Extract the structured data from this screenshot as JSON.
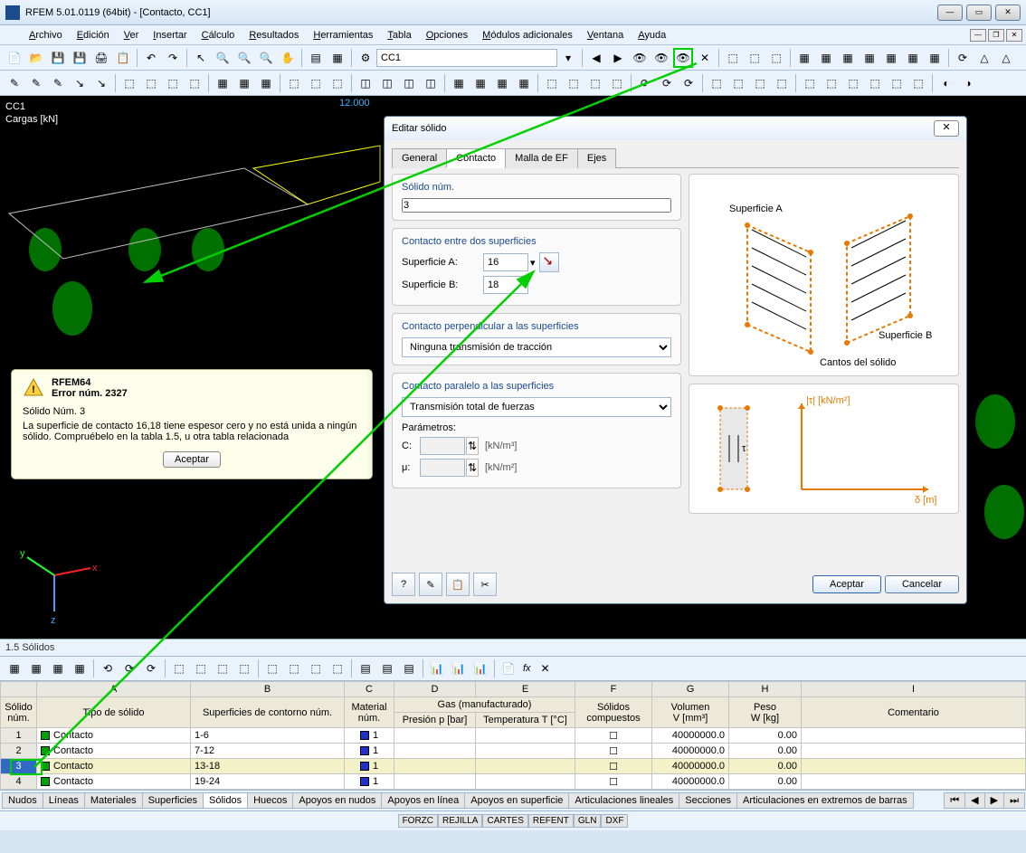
{
  "window": {
    "title": "RFEM 5.01.0119 (64bit) - [Contacto, CC1]"
  },
  "menu": [
    "Archivo",
    "Edición",
    "Ver",
    "Insertar",
    "Cálculo",
    "Resultados",
    "Herramientas",
    "Tabla",
    "Opciones",
    "Módulos adicionales",
    "Ventana",
    "Ayuda"
  ],
  "toolbar_combo": {
    "value": "CC1"
  },
  "viewport": {
    "label1": "CC1",
    "label2": "Cargas [kN]",
    "dim": "12.000",
    "axis_x": "x",
    "axis_y": "y",
    "axis_z": "z"
  },
  "error": {
    "title": "RFEM64",
    "subtitle": "Error núm. 2327",
    "line1": "Sólido Núm. 3",
    "line2": "La superficie de contacto 16,18 tiene espesor cero y no está unida a ningún sólido. Compruébelo en la tabla 1.5, u otra tabla relacionada",
    "accept": "Aceptar"
  },
  "dialog": {
    "title": "Editar sólido",
    "tabs": [
      "General",
      "Contacto",
      "Malla de EF",
      "Ejes"
    ],
    "active_tab": 1,
    "sec1": {
      "title": "Sólido núm.",
      "value": "3"
    },
    "sec2": {
      "title": "Contacto entre dos superficies",
      "labelA": "Superficie A:",
      "valA": "16",
      "labelB": "Superficie B:",
      "valB": "18"
    },
    "sec3": {
      "title": "Contacto perpendicular a las superficies",
      "value": "Ninguna transmisión de tracción"
    },
    "sec4": {
      "title": "Contacto paralelo a las superficies",
      "value": "Transmisión total de fuerzas",
      "params_label": "Parámetros:",
      "c_label": "C:",
      "c_unit": "[kN/m³]",
      "mu_label": "μ:",
      "mu_unit": "[kN/m²]"
    },
    "diagram_labels": {
      "surfA": "Superficie A",
      "surfB": "Superficie B",
      "edges": "Cantos del sólido",
      "tau": "|τ| [kN/m²]",
      "delta": "δ [m]"
    },
    "accept": "Aceptar",
    "cancel": "Cancelar"
  },
  "table": {
    "caption": "1.5 Sólidos",
    "fx": "fx",
    "col_letters": [
      "",
      "A",
      "B",
      "C",
      "D",
      "E",
      "F",
      "G",
      "H",
      "I"
    ],
    "headers_r1": {
      "num": "Sólido\nnúm.",
      "tipo": "Tipo de sólido",
      "sup": "Superficies de contorno núm.",
      "mat": "Material\nnúm.",
      "gas": "Gas (manufacturado)",
      "compuestos": "Sólidos\ncompuestos",
      "vol": "Volumen\nV [mm³]",
      "peso": "Peso\nW [kg]",
      "com": "Comentario"
    },
    "headers_gas": {
      "p": "Presión p [bar]",
      "t": "Temperatura T [°C]"
    },
    "rows": [
      {
        "n": "1",
        "tipo": "Contacto",
        "sup": "1-6",
        "mat": "1",
        "p": "",
        "t": "",
        "comp": false,
        "vol": "40000000.0",
        "peso": "0.00",
        "com": ""
      },
      {
        "n": "2",
        "tipo": "Contacto",
        "sup": "7-12",
        "mat": "1",
        "p": "",
        "t": "",
        "comp": false,
        "vol": "40000000.0",
        "peso": "0.00",
        "com": ""
      },
      {
        "n": "3",
        "tipo": "Contacto",
        "sup": "13-18",
        "mat": "1",
        "p": "",
        "t": "",
        "comp": false,
        "vol": "40000000.0",
        "peso": "0.00",
        "com": ""
      },
      {
        "n": "4",
        "tipo": "Contacto",
        "sup": "19-24",
        "mat": "1",
        "p": "",
        "t": "",
        "comp": false,
        "vol": "40000000.0",
        "peso": "0.00",
        "com": ""
      }
    ],
    "selected_row": 2,
    "bottom_tabs": [
      "Nudos",
      "Líneas",
      "Materiales",
      "Superficies",
      "Sólidos",
      "Huecos",
      "Apoyos en nudos",
      "Apoyos en línea",
      "Apoyos en superficie",
      "Articulaciones lineales",
      "Secciones",
      "Articulaciones en extremos de barras"
    ],
    "active_bottom_tab": 4
  },
  "status": [
    "FORZC",
    "REJILLA",
    "CARTES",
    "REFENT",
    "GLN",
    "DXF"
  ]
}
